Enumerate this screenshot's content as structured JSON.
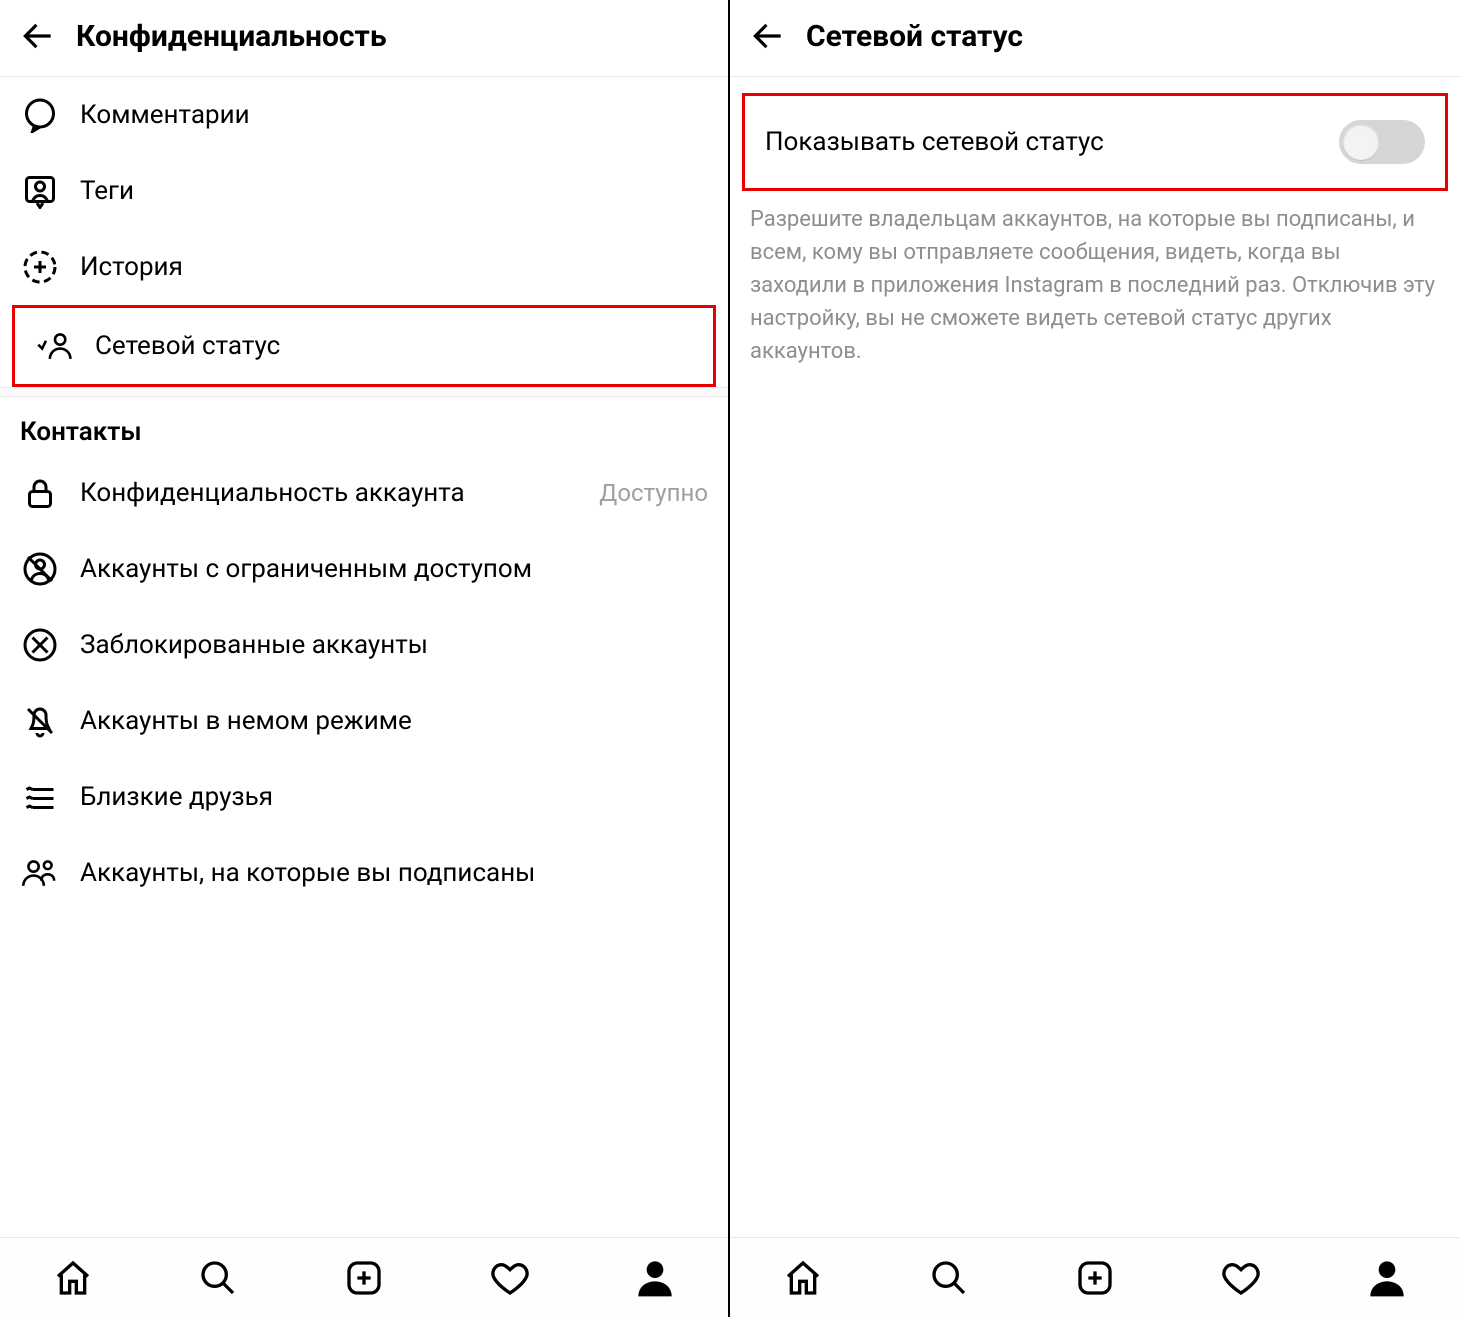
{
  "left": {
    "title": "Конфиденциальность",
    "items": [
      {
        "key": "comments",
        "label": "Комментарии"
      },
      {
        "key": "tags",
        "label": "Теги"
      },
      {
        "key": "story",
        "label": "История"
      },
      {
        "key": "activity-status",
        "label": "Сетевой статус",
        "highlight": true
      }
    ],
    "contacts_section": "Контакты",
    "contacts": [
      {
        "key": "account-privacy",
        "label": "Конфиденциальность аккаунта",
        "trailing": "Доступно"
      },
      {
        "key": "restricted",
        "label": "Аккаунты с ограниченным доступом"
      },
      {
        "key": "blocked",
        "label": "Заблокированные аккаунты"
      },
      {
        "key": "muted",
        "label": "Аккаунты в немом режиме"
      },
      {
        "key": "close-friends",
        "label": "Близкие друзья"
      },
      {
        "key": "following",
        "label": "Аккаунты, на которые вы подписаны"
      }
    ]
  },
  "right": {
    "title": "Сетевой статус",
    "toggle_label": "Показывать сетевой статус",
    "toggle_on": false,
    "description": "Разрешите владельцам аккаунтов, на которые вы подписаны, и всем, кому вы отправляете сообщения, видеть, когда вы заходили в приложения Instagram в последний раз. Отключив эту настройку, вы не сможете видеть сетевой статус других аккаунтов."
  },
  "nav": [
    "home",
    "search",
    "add",
    "activity",
    "profile"
  ]
}
